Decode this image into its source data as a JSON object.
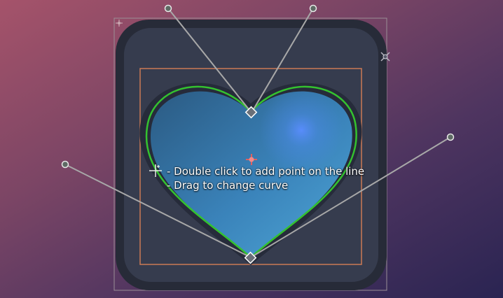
{
  "canvas": {
    "background_gradient": [
      "#a5536a",
      "#7b4565",
      "#4f3560",
      "#2a2452"
    ],
    "panel_outer_color": "#272b38",
    "panel_inner_color": "#363c4e",
    "selection_rect_color": "#cc7a55",
    "bounds_rect_color": "#9a8f96",
    "outline_color": "#34c22f",
    "heart_colors": [
      "#2d5b84",
      "#3f86bd",
      "#4aa1d4"
    ],
    "heart_highlight": "#4b8cff",
    "handle_line_color": "#a8a8a8"
  },
  "hints": {
    "line1": "- Double click to add point on the line",
    "line2": "- Drag to change curve"
  },
  "icons": {
    "cursor": "crosshair-cursor-icon",
    "pivot": "pivot-icon",
    "resize": "resize-handle-icon",
    "anchor": "anchor-icon"
  }
}
